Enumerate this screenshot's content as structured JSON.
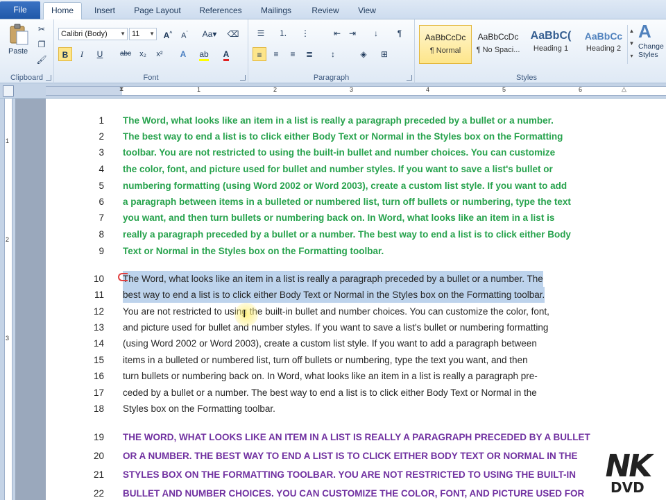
{
  "tabs": [
    "File",
    "Home",
    "Insert",
    "Page Layout",
    "References",
    "Mailings",
    "Review",
    "View"
  ],
  "ribbon": {
    "clipboard": {
      "label": "Clipboard",
      "paste": "Paste"
    },
    "font": {
      "label": "Font",
      "font_name": "Calibri (Body)",
      "font_size": "11"
    },
    "paragraph": {
      "label": "Paragraph"
    },
    "styles": {
      "label": "Styles",
      "items": [
        {
          "sample": "AaBbCcDc",
          "name": "¶ Normal"
        },
        {
          "sample": "AaBbCcDc",
          "name": "¶ No Spaci..."
        },
        {
          "sample": "AaBbC(",
          "name": "Heading 1"
        },
        {
          "sample": "AaBbCc",
          "name": "Heading 2"
        }
      ],
      "change": "Change Styles"
    }
  },
  "ruler": {
    "numbers": [
      "1",
      "2",
      "3",
      "4",
      "5",
      "6"
    ]
  },
  "vruler": {
    "numbers": [
      "1",
      "2",
      "3"
    ]
  },
  "document": {
    "lines": [
      {
        "n": "1",
        "style": "green",
        "text": "The  Word, what looks like an item in a list is really a paragraph preceded by a bullet or a number."
      },
      {
        "n": "2",
        "style": "green",
        "text": "The best way to end a list is to click either Body Text or Normal in the Styles box on the Formatting"
      },
      {
        "n": "3",
        "style": "green",
        "text": "toolbar.    You are not restricted to using the built-in bullet and number choices. You can customize"
      },
      {
        "n": "4",
        "style": "green",
        "text": "the color, font, and picture used for bullet and number styles. If you want to save a list's bullet or"
      },
      {
        "n": "5",
        "style": "green",
        "text": "numbering formatting (using Word 2002 or Word 2003), create a custom list style. If you want to add"
      },
      {
        "n": "6",
        "style": "green",
        "text": "a paragraph between items in a bulleted or numbered list, turn off bullets or numbering, type the text"
      },
      {
        "n": "7",
        "style": "green",
        "text": "you want, and then turn bullets or numbering back on.    In Word, what looks like an item in a list is"
      },
      {
        "n": "8",
        "style": "green",
        "text": "really a paragraph preceded by a bullet or a number.  The best way to end a list is to click either Body"
      },
      {
        "n": "9",
        "style": "green",
        "text": "Text or Normal in the Styles box on the Formatting toolbar."
      },
      {
        "n": "10",
        "style": "black",
        "text": "The  Word, what looks like an item in a list is really a paragraph preceded by a bullet or a number.  The"
      },
      {
        "n": "11",
        "style": "black",
        "text": "best way to end a list is to click either Body Text or Normal in the Styles box on the Formatting toolbar."
      },
      {
        "n": "12",
        "style": "black",
        "text": "You are not restricted to using the built-in bullet and number choices. You can customize the color, font,"
      },
      {
        "n": "13",
        "style": "black",
        "text": "and picture used for bullet and number styles. If you want to save a list's bullet or numbering formatting"
      },
      {
        "n": "14",
        "style": "black",
        "text": "(using Word 2002 or Word 2003), create a custom list style. If you want to add a paragraph between"
      },
      {
        "n": "15",
        "style": "black",
        "text": "items in a bulleted or numbered list, turn off bullets or numbering, type the text you want, and then"
      },
      {
        "n": "16",
        "style": "black",
        "text": "turn bullets or numbering back on.    In Word, what looks like an item in a list is really a paragraph pre-"
      },
      {
        "n": "17",
        "style": "black",
        "text": "ceded by a bullet or a number.  The best way to end a list is to click either Body Text or Normal in the"
      },
      {
        "n": "18",
        "style": "black",
        "text": "Styles box on the Formatting toolbar."
      },
      {
        "n": "19",
        "style": "purple",
        "text": "THE  WORD, WHAT LOOKS LIKE AN ITEM IN A LIST IS REALLY A PARAGRAPH PRECEDED BY A BULLET"
      },
      {
        "n": "20",
        "style": "purple",
        "text": "OR A NUMBER.  THE BEST WAY TO END A LIST IS TO CLICK EITHER BODY TEXT OR NORMAL IN THE"
      },
      {
        "n": "21",
        "style": "purple",
        "text": "STYLES BOX ON THE FORMATTING TOOLBAR.    YOU ARE NOT RESTRICTED TO USING THE BUILT-IN"
      },
      {
        "n": "22",
        "style": "purple",
        "text": "BULLET AND NUMBER CHOICES. YOU CAN CUSTOMIZE THE COLOR, FONT, AND PICTURE USED FOR"
      }
    ]
  },
  "logo": {
    "top": "NK",
    "bottom": "DVD"
  }
}
